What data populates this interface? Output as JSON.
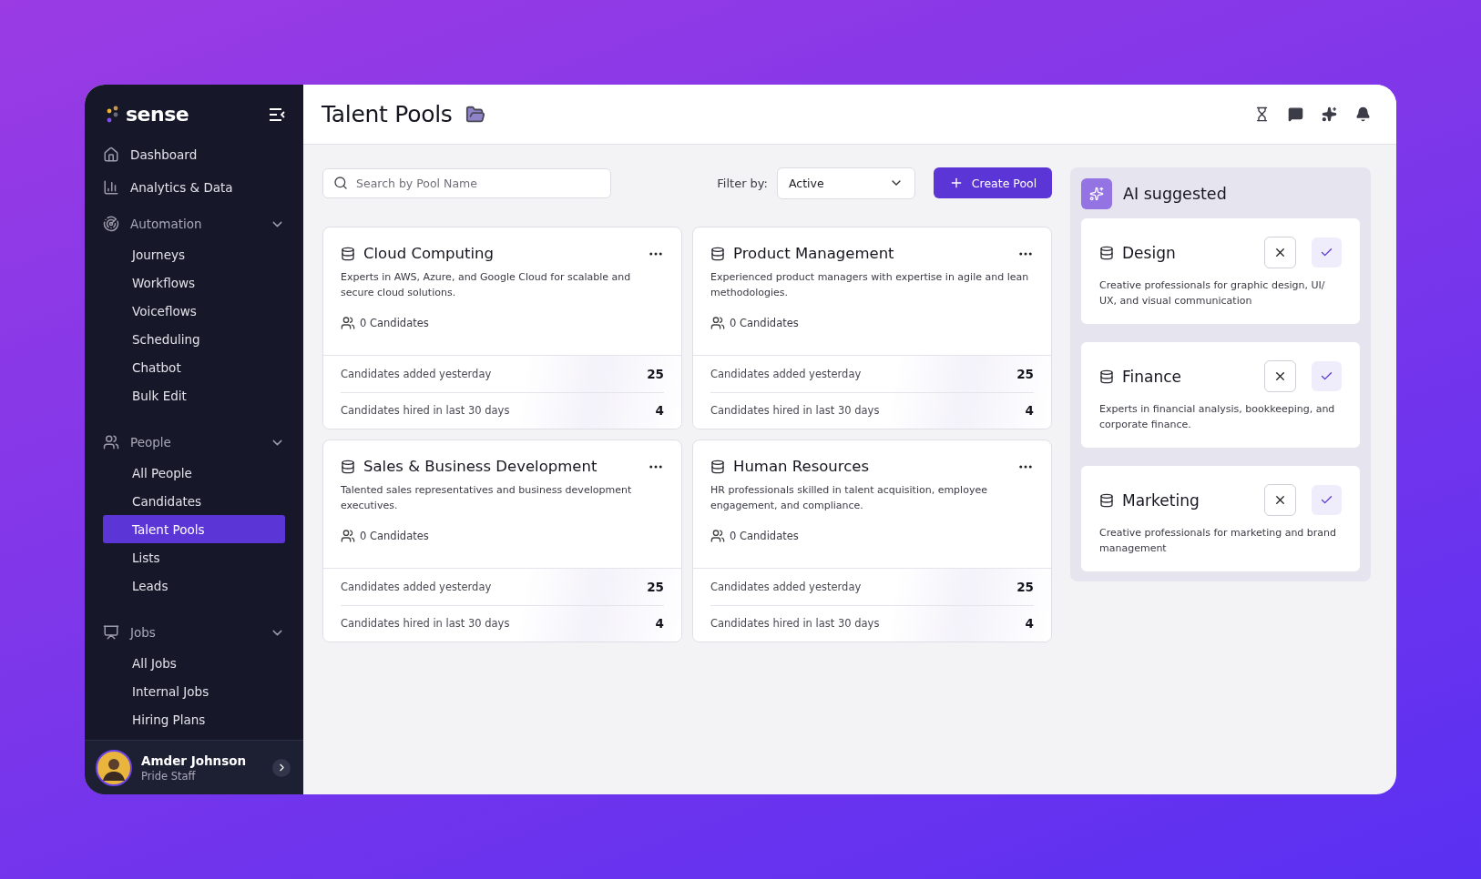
{
  "sidebar": {
    "logo": "sense",
    "items": [
      {
        "label": "Dashboard",
        "selected": false
      },
      {
        "label": "Analytics & Data",
        "selected": false
      },
      {
        "label": "Automation",
        "expanded": true,
        "children": [
          {
            "label": "Journeys",
            "selected": false
          },
          {
            "label": "Workflows",
            "selected": false
          },
          {
            "label": "Voiceflows",
            "selected": false
          },
          {
            "label": "Scheduling",
            "selected": false
          },
          {
            "label": "Chatbot",
            "selected": false
          },
          {
            "label": "Bulk Edit",
            "selected": false
          }
        ]
      },
      {
        "label": "People",
        "expanded": true,
        "children": [
          {
            "label": "All People",
            "selected": false
          },
          {
            "label": "Candidates",
            "selected": false
          },
          {
            "label": "Talent Pools",
            "selected": true
          },
          {
            "label": "Lists",
            "selected": false
          },
          {
            "label": "Leads",
            "selected": false
          }
        ]
      },
      {
        "label": "Jobs",
        "expanded": true,
        "children": [
          {
            "label": "All Jobs",
            "selected": false
          },
          {
            "label": "Internal Jobs",
            "selected": false
          },
          {
            "label": "Hiring Plans",
            "selected": false
          }
        ]
      }
    ],
    "user": {
      "name": "Amder Johnson",
      "role": "Pride Staff"
    }
  },
  "header": {
    "title": "Talent Pools"
  },
  "toolbar": {
    "search_placeholder": "Search by Pool Name",
    "filter_label": "Filter by:",
    "filter_value": "Active",
    "create_label": "Create Pool"
  },
  "pools": [
    {
      "title": "Cloud Computing",
      "description": "Experts in AWS, Azure, and Google Cloud for scalable and secure cloud solutions.",
      "candidates": "0 Candidates",
      "stats": [
        {
          "label": "Candidates added yesterday",
          "value": "25"
        },
        {
          "label": "Candidates hired in last 30 days",
          "value": "4"
        }
      ]
    },
    {
      "title": "Product Management",
      "description": "Experienced product managers with expertise in agile and lean methodologies.",
      "candidates": "0 Candidates",
      "stats": [
        {
          "label": "Candidates added yesterday",
          "value": "25"
        },
        {
          "label": "Candidates hired in last 30 days",
          "value": "4"
        }
      ]
    },
    {
      "title": "Sales & Business Development",
      "description": "Talented sales representatives and business development executives.",
      "candidates": "0 Candidates",
      "stats": [
        {
          "label": "Candidates added yesterday",
          "value": "25"
        },
        {
          "label": "Candidates hired in last 30 days",
          "value": "4"
        }
      ]
    },
    {
      "title": "Human Resources",
      "description": "HR professionals skilled in talent acquisition, employee engagement, and compliance.",
      "candidates": "0 Candidates",
      "stats": [
        {
          "label": "Candidates added yesterday",
          "value": "25"
        },
        {
          "label": "Candidates hired in last 30 days",
          "value": "4"
        }
      ]
    }
  ],
  "ai_panel": {
    "title": "AI suggested",
    "suggestions": [
      {
        "title": "Design",
        "description": "Creative professionals for graphic design, UI/ UX, and visual communication"
      },
      {
        "title": "Finance",
        "description": "Experts in financial analysis, bookkeeping, and corporate finance."
      },
      {
        "title": "Marketing",
        "description": "Creative professionals for marketing and brand management"
      }
    ]
  }
}
